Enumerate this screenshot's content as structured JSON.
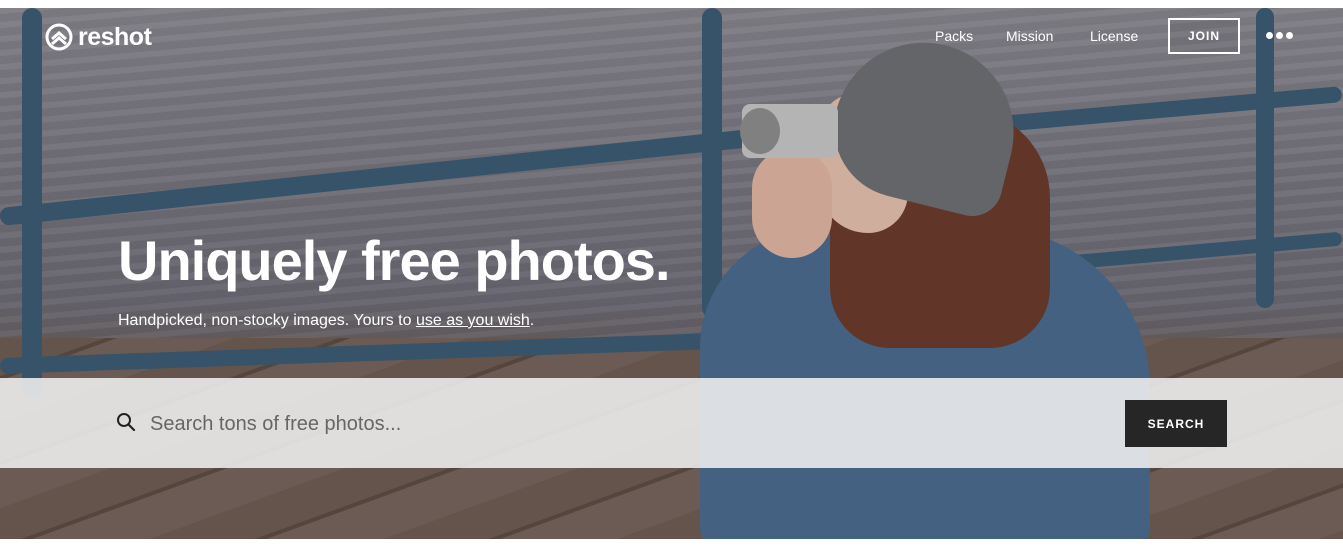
{
  "brand": {
    "name": "reshot"
  },
  "nav": {
    "links": [
      {
        "label": "Packs"
      },
      {
        "label": "Mission"
      },
      {
        "label": "License"
      }
    ],
    "join_label": "JOIN",
    "more_icon": "more-dots-icon"
  },
  "hero": {
    "headline": "Uniquely free photos.",
    "subline_prefix": "Handpicked, non-stocky images. Yours to ",
    "subline_link": "use as you wish",
    "subline_suffix": "."
  },
  "search": {
    "placeholder": "Search tons of free photos...",
    "value": "",
    "button_label": "SEARCH",
    "icon": "search-icon"
  },
  "colors": {
    "search_button": "#262626",
    "text_on_hero": "#ffffff"
  }
}
